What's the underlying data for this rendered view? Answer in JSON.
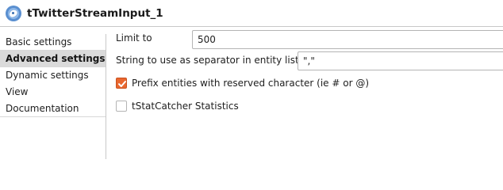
{
  "header": {
    "title": "tTwitterStreamInput_1",
    "icon": "twitter-component-icon"
  },
  "sidebar": {
    "items": [
      {
        "label": "Basic settings",
        "active": false
      },
      {
        "label": "Advanced settings",
        "active": true
      },
      {
        "label": "Dynamic settings",
        "active": false
      },
      {
        "label": "View",
        "active": false
      },
      {
        "label": "Documentation",
        "active": false
      }
    ]
  },
  "settings": {
    "limit_label": "Limit to",
    "limit_value": "500",
    "separator_label": "String to use as separator in entity lists",
    "separator_value": "\",\"",
    "prefix_label": "Prefix entities with reserved character (ie # or @)",
    "prefix_checked": true,
    "statcatcher_label": "tStatCatcher Statistics",
    "statcatcher_checked": false
  },
  "colors": {
    "accent": "#e9672f",
    "active_tab_bg": "#dadada"
  }
}
